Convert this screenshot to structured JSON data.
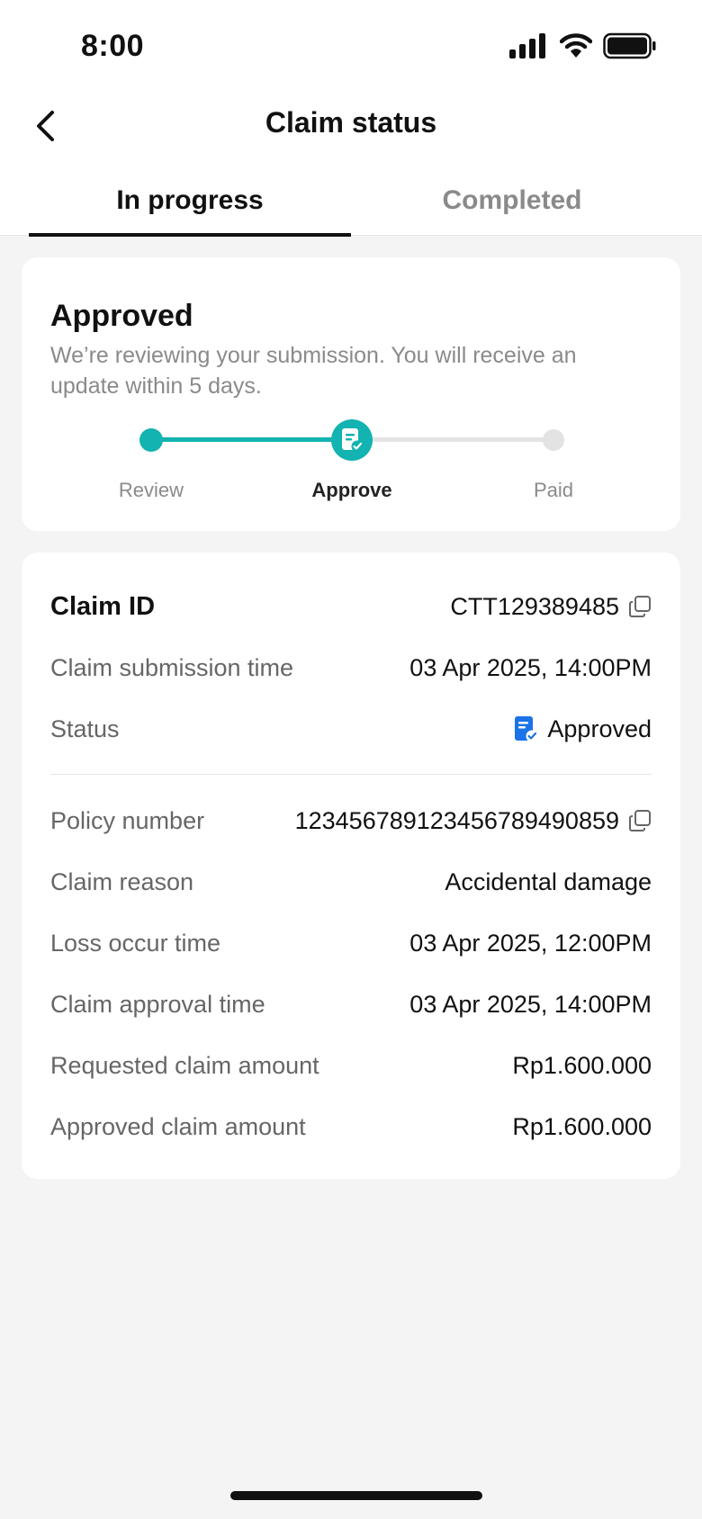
{
  "status_bar": {
    "time": "8:00"
  },
  "header": {
    "title": "Claim status"
  },
  "tabs": [
    {
      "label": "In progress",
      "active": true
    },
    {
      "label": "Completed",
      "active": false
    }
  ],
  "summary": {
    "title": "Approved",
    "description": "We’re reviewing your submission. You will receive an update within 5 days.",
    "steps": [
      {
        "label": "Review",
        "state": "done"
      },
      {
        "label": "Approve",
        "state": "current"
      },
      {
        "label": "Paid",
        "state": "todo"
      }
    ]
  },
  "details": {
    "claim_id_label": "Claim ID",
    "claim_id_value": "CTT129389485",
    "submission_label": "Claim submission time",
    "submission_value": "03 Apr 2025, 14:00PM",
    "status_label": "Status",
    "status_value": "Approved",
    "policy_label": "Policy number",
    "policy_value": "12345678912345678949085​9",
    "reason_label": "Claim reason",
    "reason_value": "Accidental damage",
    "loss_label": "Loss occur time",
    "loss_value": "03 Apr 2025, 12:00PM",
    "approval_label": "Claim approval time",
    "approval_value": "03 Apr 2025, 14:00PM",
    "requested_label": "Requested claim amount",
    "requested_value": "Rp1.600.000",
    "approved_label": "Approved claim amount",
    "approved_value": "Rp1.600.000"
  },
  "colors": {
    "accent": "#12b3b0",
    "status_icon": "#1a73e8"
  },
  "icons": [
    "signal-icon",
    "wifi-icon",
    "battery-icon",
    "back-chevron-icon",
    "document-check-icon",
    "copy-icon"
  ]
}
